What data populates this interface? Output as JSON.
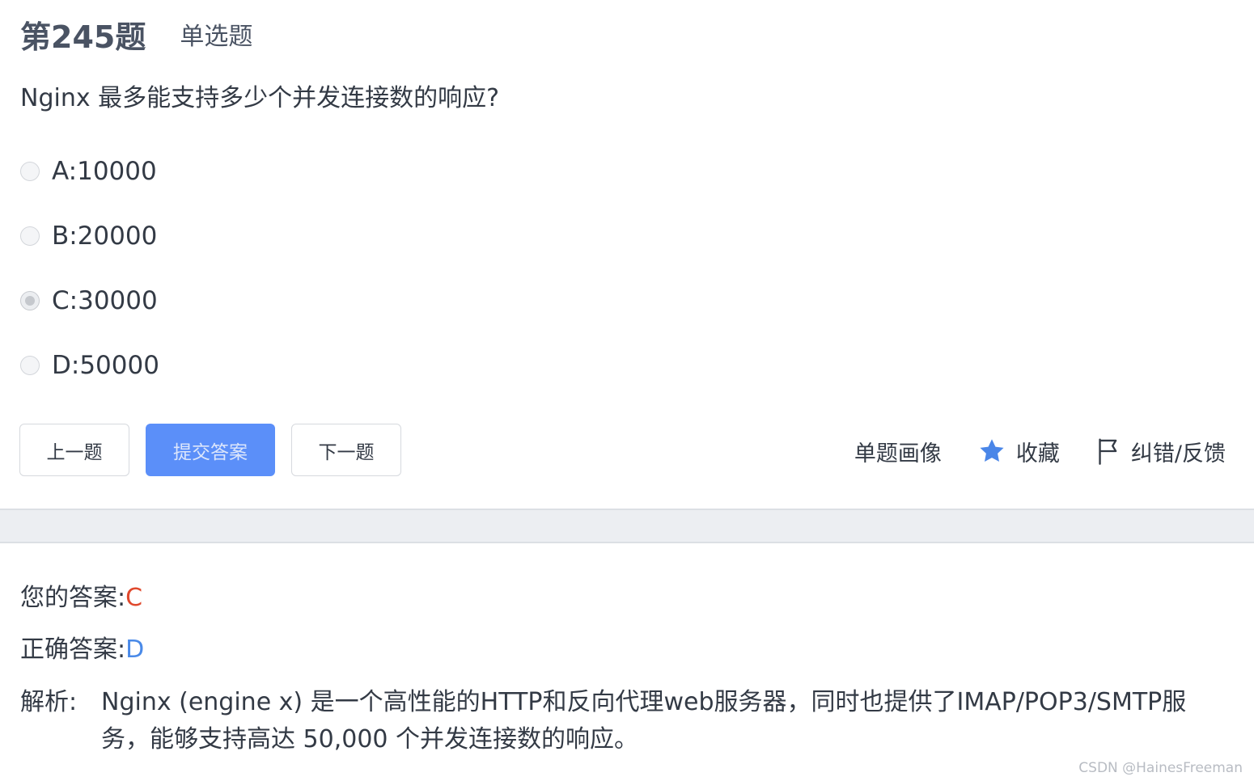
{
  "question": {
    "number": "第245题",
    "type": "单选题",
    "text": "Nginx 最多能支持多少个并发连接数的响应?"
  },
  "options": [
    {
      "label": "A:10000",
      "selected": false
    },
    {
      "label": "B:20000",
      "selected": false
    },
    {
      "label": "C:30000",
      "selected": true
    },
    {
      "label": "D:50000",
      "selected": false
    }
  ],
  "buttons": {
    "prev": "上一题",
    "submit": "提交答案",
    "next": "下一题"
  },
  "actions": {
    "portrait": "单题画像",
    "favorite": "收藏",
    "feedback": "纠错/反馈"
  },
  "result": {
    "your_answer_label": "您的答案:",
    "your_answer": "C",
    "correct_answer_label": "正确答案:",
    "correct_answer": "D",
    "analysis_label": "解析:",
    "analysis_text": "Nginx (engine x) 是一个高性能的HTTP和反向代理web服务器，同时也提供了IMAP/POP3/SMTP服务，能够支持高达 50,000 个并发连接数的响应。"
  },
  "colors": {
    "primary": "#5b8ff9",
    "wrong": "#e0492d",
    "correct": "#4a8ae8",
    "star": "#4a86e8"
  },
  "icons": {
    "favorite": "star-icon",
    "feedback": "flag-icon"
  },
  "watermark": "CSDN @HainesFreeman"
}
